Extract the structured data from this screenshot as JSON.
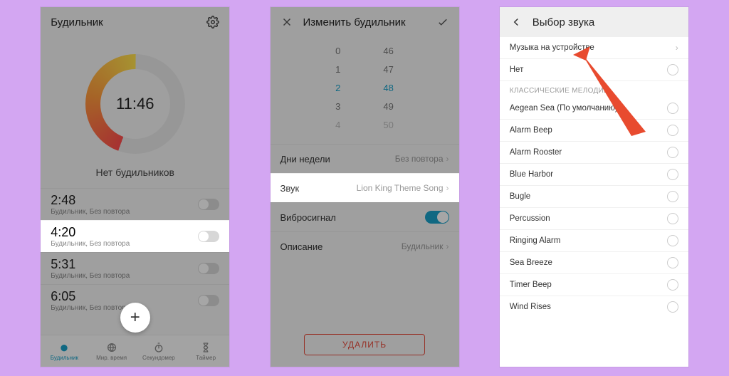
{
  "screen1": {
    "title": "Будильник",
    "clock": "11:46",
    "empty_msg": "Нет будильников",
    "alarms": [
      {
        "time": "2:48",
        "sub": "Будильник, Без повтора"
      },
      {
        "time": "4:20",
        "sub": "Будильник, Без повтора"
      },
      {
        "time": "5:31",
        "sub": "Будильник, Без повтора"
      },
      {
        "time": "6:05",
        "sub": "Будильник, Без повтора"
      }
    ],
    "tabs": [
      "Будильник",
      "Мир. время",
      "Секундомер",
      "Таймер"
    ]
  },
  "screen2": {
    "title": "Изменить будильник",
    "hours": [
      "0",
      "1",
      "2",
      "3",
      "4"
    ],
    "mins": [
      "46",
      "47",
      "48",
      "49",
      "50"
    ],
    "rows": {
      "days": {
        "label": "Дни недели",
        "value": "Без повтора"
      },
      "sound": {
        "label": "Звук",
        "value": "Lion King Theme Song"
      },
      "vibrate": {
        "label": "Вибросигнал"
      },
      "desc": {
        "label": "Описание",
        "value": "Будильник"
      }
    },
    "delete": "УДАЛИТЬ"
  },
  "screen3": {
    "title": "Выбор звука",
    "music_row": "Музыка на устройстве",
    "none_row": "Нет",
    "section": "КЛАССИЧЕСКИЕ МЕЛОДИИ",
    "melodies": [
      "Aegean Sea (По умолчанию)",
      "Alarm Beep",
      "Alarm Rooster",
      "Blue Harbor",
      "Bugle",
      "Percussion",
      "Ringing Alarm",
      "Sea Breeze",
      "Timer Beep",
      "Wind Rises"
    ]
  }
}
